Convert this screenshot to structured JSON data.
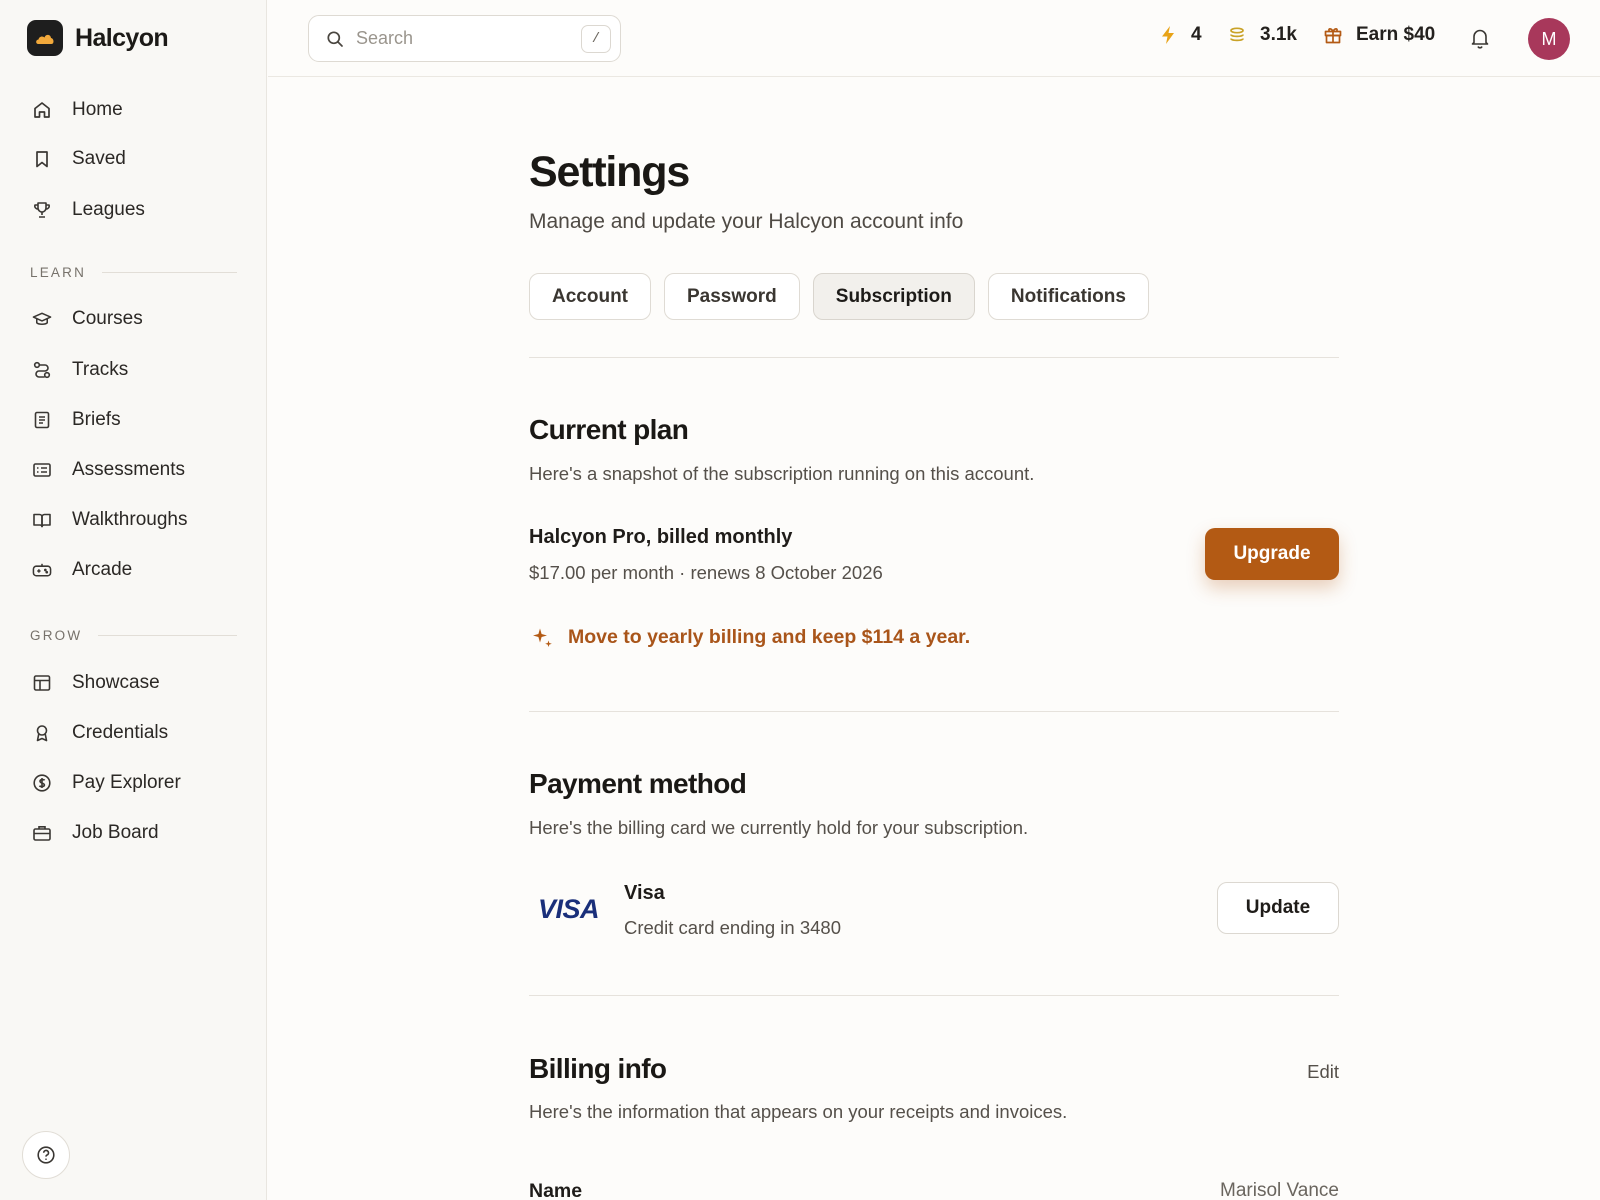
{
  "brand": {
    "name": "Halcyon"
  },
  "sidebar": {
    "main_items": [
      {
        "label": "Home",
        "icon": "home-icon"
      },
      {
        "label": "Saved",
        "icon": "bookmark-icon"
      },
      {
        "label": "Leagues",
        "icon": "trophy-icon"
      }
    ],
    "learn_label": "LEARN",
    "learn_items": [
      {
        "label": "Courses",
        "icon": "graduation-cap-icon"
      },
      {
        "label": "Tracks",
        "icon": "route-icon"
      },
      {
        "label": "Briefs",
        "icon": "document-icon"
      },
      {
        "label": "Assessments",
        "icon": "list-card-icon"
      },
      {
        "label": "Walkthroughs",
        "icon": "book-open-icon"
      },
      {
        "label": "Arcade",
        "icon": "gamepad-icon"
      }
    ],
    "grow_label": "GROW",
    "grow_items": [
      {
        "label": "Showcase",
        "icon": "layout-icon"
      },
      {
        "label": "Credentials",
        "icon": "award-icon"
      },
      {
        "label": "Pay Explorer",
        "icon": "dollar-circle-icon"
      },
      {
        "label": "Job Board",
        "icon": "briefcase-icon"
      }
    ],
    "help_icon": "help-circle-icon"
  },
  "topbar": {
    "search_placeholder": "Search",
    "search_shortcut": "/",
    "streak_count": "4",
    "coins": "3.1k",
    "earn_label": "Earn $40",
    "avatar_initial": "M",
    "colors": {
      "streak": "#e8a317",
      "coins": "#c9a227",
      "gift": "#b35a14",
      "avatar": "#a8385b"
    }
  },
  "page": {
    "title": "Settings",
    "subtitle": "Manage and update your Halcyon account info",
    "tabs": [
      "Account",
      "Password",
      "Subscription",
      "Notifications"
    ],
    "active_tab": "Subscription"
  },
  "current_plan": {
    "title": "Current plan",
    "description": "Here's a snapshot of the subscription running on this account.",
    "plan_name": "Halcyon Pro, billed monthly",
    "plan_price": "$17.00 per month · renews 8 October 2026",
    "upgrade_label": "Upgrade",
    "promo": "Move to yearly billing and keep $114 a year.",
    "accent_color": "#b35a14"
  },
  "payment_method": {
    "title": "Payment method",
    "description": "Here's the billing card we currently hold for your subscription.",
    "brand_logo": "VISA",
    "card_name": "Visa",
    "card_desc": "Credit card ending in 3480",
    "update_label": "Update"
  },
  "billing_info": {
    "title": "Billing info",
    "edit_label": "Edit",
    "description": "Here's the information that appears on your receipts and invoices.",
    "name_label": "Name",
    "name_value": "Marisol Vance"
  }
}
